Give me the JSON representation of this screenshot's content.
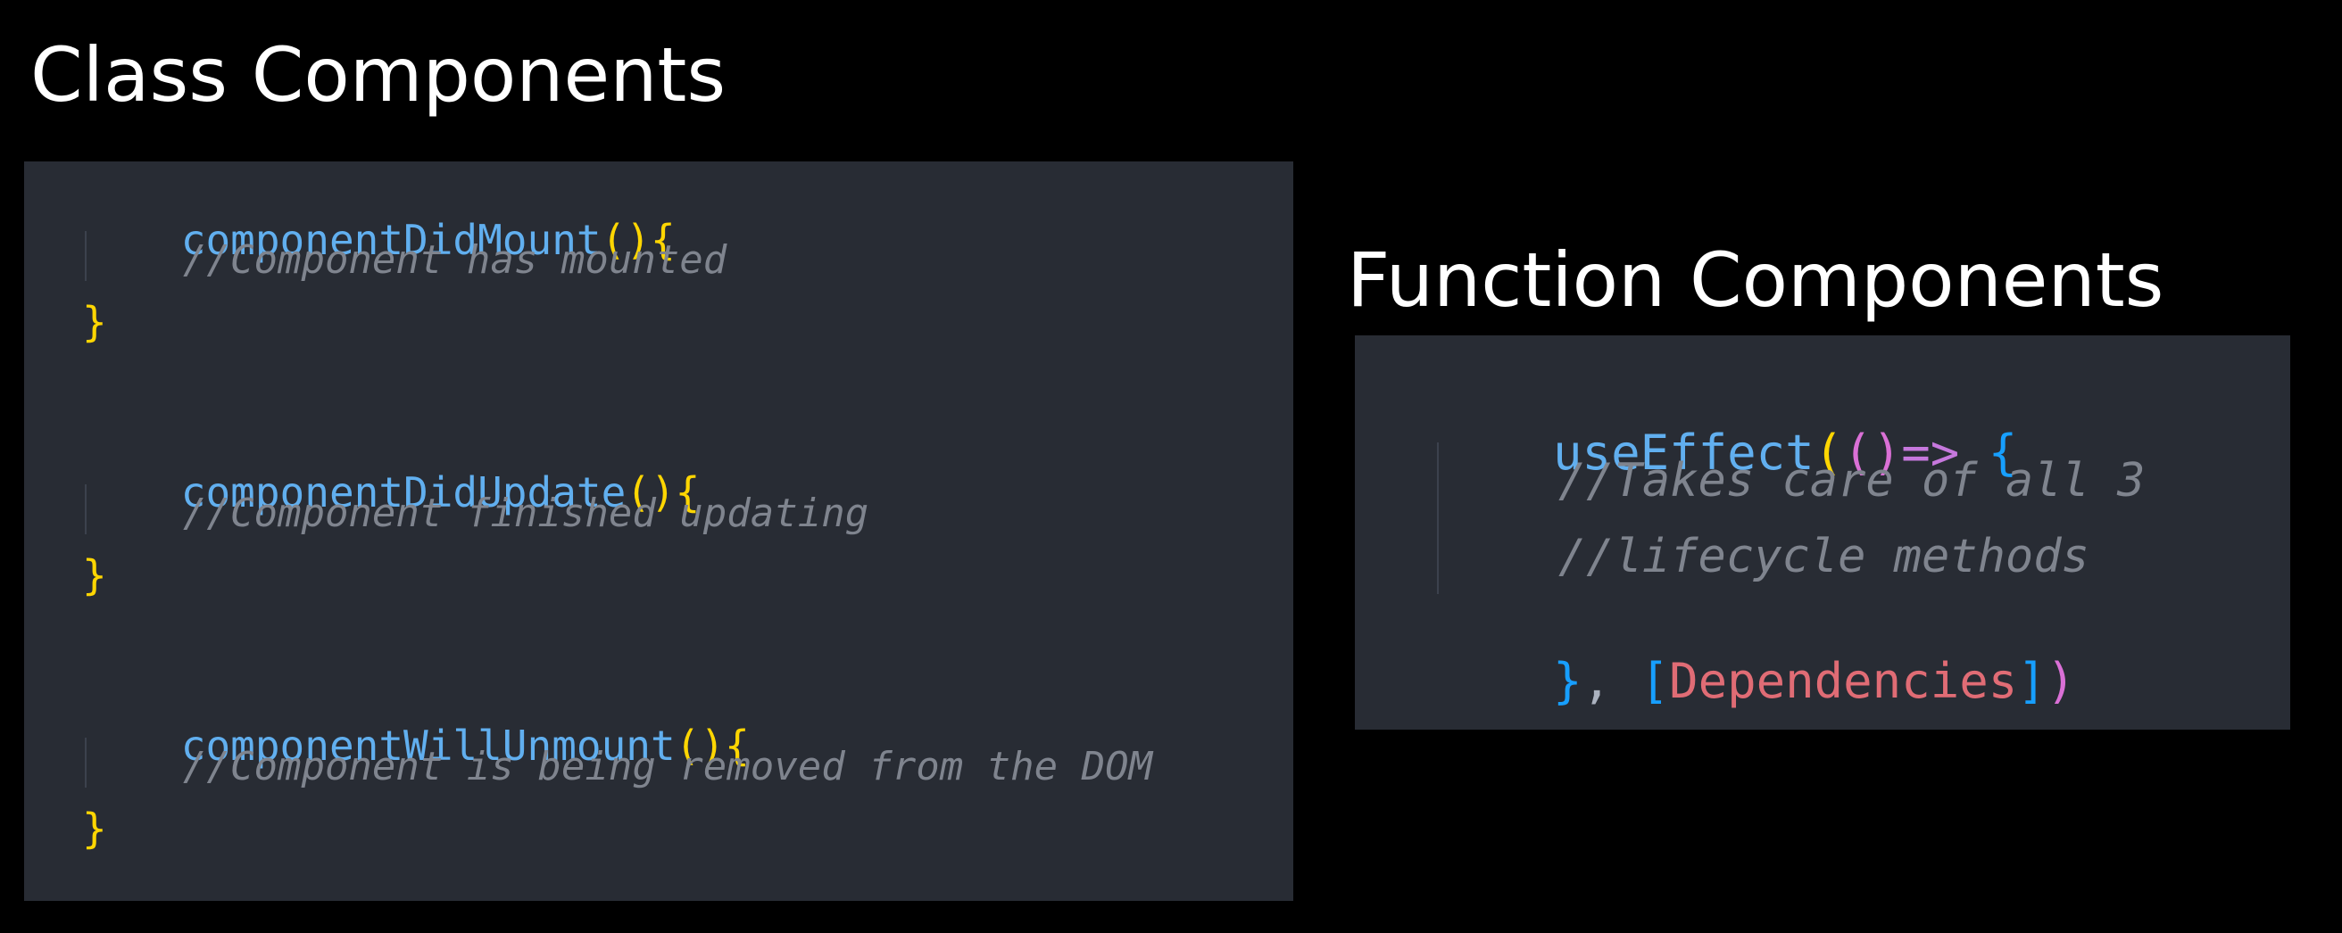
{
  "class_section": {
    "title": "Class Components",
    "blocks": [
      {
        "method": "componentDidMount",
        "parens": "()",
        "open_brace": "{",
        "comment": "//Component has mounted",
        "close_brace": "}"
      },
      {
        "method": "componentDidUpdate",
        "parens": "()",
        "open_brace": "{",
        "comment": "//Component finished updating",
        "close_brace": "}"
      },
      {
        "method": "componentWillUnmount",
        "parens": "()",
        "open_brace": "{",
        "comment": "//Component is being removed from the DOM",
        "close_brace": "}"
      }
    ]
  },
  "function_section": {
    "title": "Function Components",
    "hook": "useEffect",
    "open_paren": "(",
    "arrow_params": "()",
    "arrow": "=>",
    "open_brace": "{",
    "comments": [
      "//Takes care of all 3",
      "//lifecycle methods"
    ],
    "close_brace": "}",
    "comma": ",",
    "deps_open": "[",
    "deps_name": "Dependencies",
    "deps_close": "]",
    "close_paren": ")"
  },
  "colors": {
    "background": "#000000",
    "panel": "#282c34",
    "function_name": "#61afef",
    "bracket_yellow": "#ffd602",
    "bracket_pink": "#da70d6",
    "bracket_blue": "#179fff",
    "arrow_purple": "#c678dd",
    "comment_gray": "#7f848e",
    "dependency_red": "#e06c75"
  }
}
